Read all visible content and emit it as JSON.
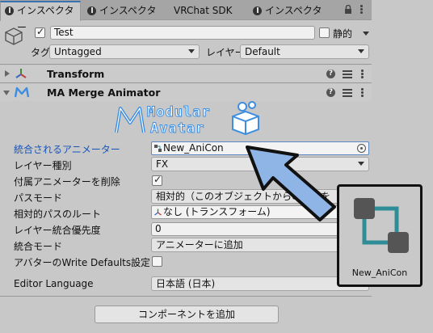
{
  "tabs": [
    {
      "label": "インスペクター",
      "active": true
    },
    {
      "label": "インスペクター",
      "active": false
    },
    {
      "label": "VRChat SDK",
      "active": false
    },
    {
      "label": "インスペクター",
      "active": false
    }
  ],
  "object": {
    "active_checked": true,
    "name": "Test",
    "static_label": "静的",
    "tag_label": "タグ",
    "tag_value": "Untagged",
    "layer_label": "レイヤー",
    "layer_value": "Default"
  },
  "components": {
    "transform": {
      "title": "Transform"
    },
    "merge_animator": {
      "title": "MA Merge Animator"
    }
  },
  "logo": {
    "line1": "Modular",
    "line2": "Avatar"
  },
  "properties": {
    "animator_label": "統合されるアニメーター",
    "animator_value": "New_AniCon",
    "layer_type_label": "レイヤー種別",
    "layer_type_value": "FX",
    "delete_attached_label": "付属アニメーターを削除",
    "delete_attached_checked": true,
    "path_mode_label": "パスモード",
    "path_mode_value": "相対的（このオブジェクトからのパスを",
    "relative_root_label": "相対的パスのルート",
    "relative_root_value": "なし (トランスフォーム)",
    "layer_priority_label": "レイヤー統合優先度",
    "layer_priority_value": "0",
    "merge_mode_label": "統合モード",
    "merge_mode_value": "アニメーターに追加",
    "write_defaults_label": "アバターのWrite Defaults設定に合",
    "write_defaults_checked": false,
    "editor_language_label": "Editor Language",
    "editor_language_value": "日本語 (日本)"
  },
  "add_component_label": "コンポーネントを追加",
  "overlay_asset": {
    "label": "New_AniCon"
  },
  "colors": {
    "accent_blue": "#1a55b8",
    "arrow_fill": "#8fb4e6",
    "asset_teal": "#2e8d97"
  }
}
